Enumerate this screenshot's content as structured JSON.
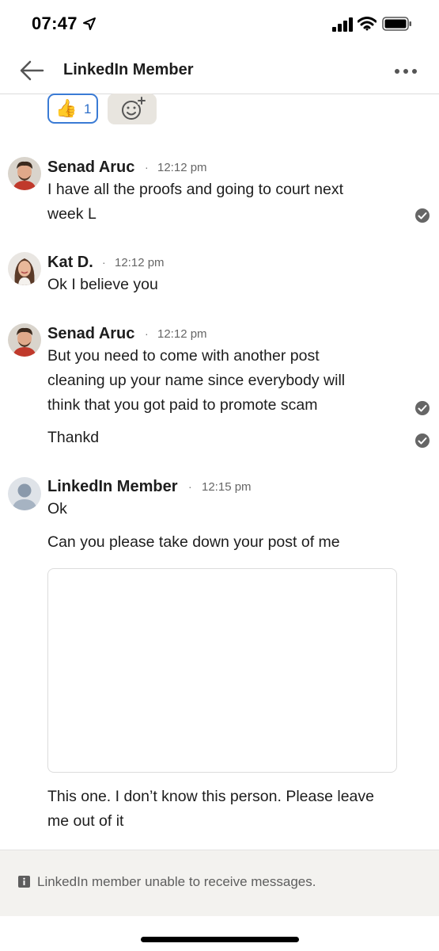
{
  "status_bar": {
    "time": "07:47"
  },
  "header": {
    "title": "LinkedIn Member"
  },
  "reaction": {
    "emoji": "👍",
    "count": "1"
  },
  "messages": [
    {
      "sender": "Senad Aruc",
      "time": "12:12 pm",
      "lines": [
        "I have all the proofs and going to court next",
        "week L"
      ]
    },
    {
      "sender": "Kat D.",
      "time": "12:12 pm",
      "lines": [
        "Ok I believe you"
      ]
    },
    {
      "sender": "Senad Aruc",
      "time": "12:12 pm",
      "lines": [
        "But you need to come with another post",
        "cleaning up your name since everybody will",
        "think that you got paid to promote scam"
      ],
      "followup": "Thankd"
    },
    {
      "sender": "LinkedIn Member",
      "time": "12:15 pm",
      "lines": [
        "Ok"
      ],
      "followup": "Can you please take down your post of me",
      "after_image": [
        "This one. I don’t know this person. Please leave",
        "me out of it"
      ]
    }
  ],
  "separator": "·",
  "footer": {
    "notice": "LinkedIn member unable to receive messages."
  },
  "colors": {
    "accent": "#3a7bd5",
    "check": "#666666",
    "footer_bg": "#f3f2ef"
  }
}
